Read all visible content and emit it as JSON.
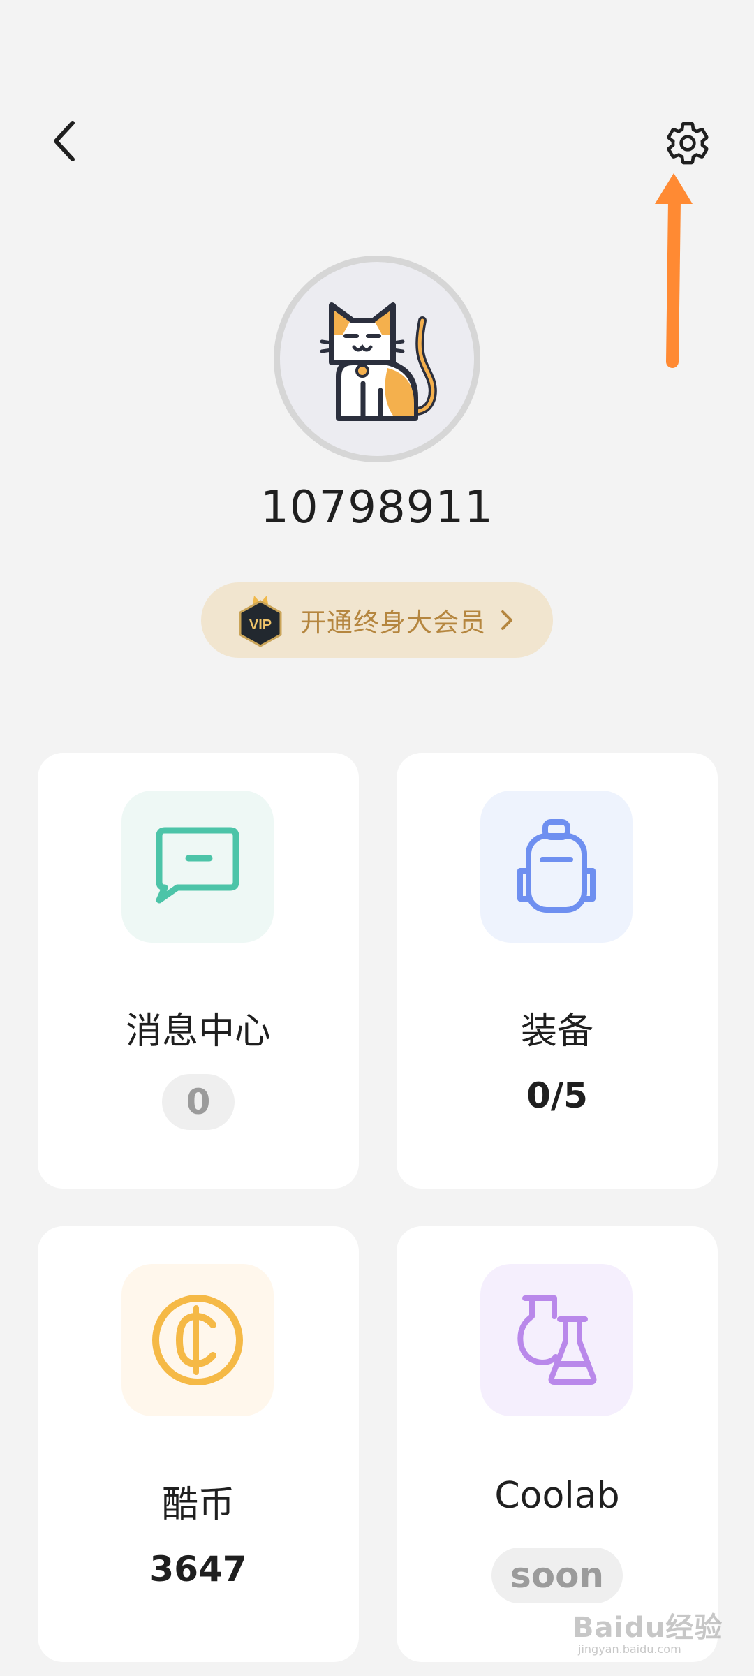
{
  "header": {
    "back_icon": "chevron-left-icon",
    "settings_icon": "gear-icon"
  },
  "annotation": {
    "color": "#ff8a33"
  },
  "profile": {
    "avatar_icon": "cat-icon",
    "user_id": "10798911",
    "vip_badge": "VIP",
    "vip_label": "开通终身大会员"
  },
  "cards": [
    {
      "icon": "chat-bubble-icon",
      "title": "消息中心",
      "value": "0",
      "accent": "#4cc4a8"
    },
    {
      "icon": "backpack-icon",
      "title": "装备",
      "value": "0/5",
      "accent": "#6e8ff0"
    },
    {
      "icon": "coin-icon",
      "title": "酷币",
      "value": "3647",
      "accent": "#f5b946"
    },
    {
      "icon": "flask-icon",
      "title": "Coolab",
      "value": "soon",
      "accent": "#b988ea"
    }
  ],
  "watermark": {
    "text": "Baidu经验",
    "sub": "jingyan.baidu.com"
  }
}
